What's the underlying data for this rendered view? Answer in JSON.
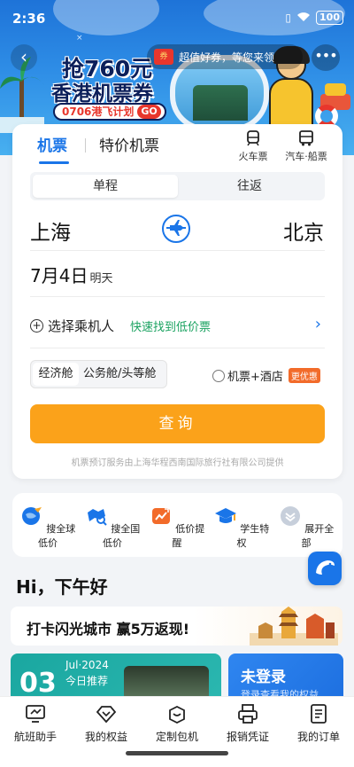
{
  "status": {
    "time": "2:36",
    "battery": "100"
  },
  "banner": {
    "logo_text": "×",
    "slogan_line1": "抢760元",
    "slogan_line2": "香港机票券",
    "tag": "0706港飞计划",
    "tag_go": "GO",
    "promo_pill": "超值好券，等您来领"
  },
  "tabs": {
    "flight": "机票",
    "special": "特价机票"
  },
  "modes": {
    "train": "火车票",
    "bus": "汽车·船票"
  },
  "trip": {
    "single": "单程",
    "round": "往返"
  },
  "route": {
    "from": "上海",
    "to": "北京"
  },
  "date": {
    "main": "7月4日",
    "sub": "明天"
  },
  "passenger": {
    "label": "选择乘机人",
    "link": "快速找到低价票"
  },
  "cabin": {
    "economy": "经济舱",
    "business": "公务舱/头等舱"
  },
  "hotel": {
    "label": "机票+酒店",
    "badge": "更优惠"
  },
  "search": {
    "label": "查询"
  },
  "provider": "机票预订服务由上海华程西南国际旅行社有限公司提供",
  "quick": [
    {
      "label": "搜全球低价"
    },
    {
      "label": "搜全国低价"
    },
    {
      "label": "低价提醒"
    },
    {
      "label": "学生特权"
    },
    {
      "label": "展开全部"
    }
  ],
  "greeting": "Hi，下午好",
  "checkin_banner": "打卡闪光城市 赢5万返现!",
  "rec_card": {
    "day": "03",
    "month": "Jul·2024",
    "text": "今日推荐"
  },
  "login_card": {
    "title": "未登录",
    "sub": "登录查看我的权益"
  },
  "bottom_nav": [
    {
      "label": "航班助手"
    },
    {
      "label": "我的权益"
    },
    {
      "label": "定制包机"
    },
    {
      "label": "报销凭证"
    },
    {
      "label": "我的订单"
    }
  ],
  "colors": {
    "primary": "#1a75e8",
    "search": "#fba21a",
    "link_green": "#1aa260"
  }
}
